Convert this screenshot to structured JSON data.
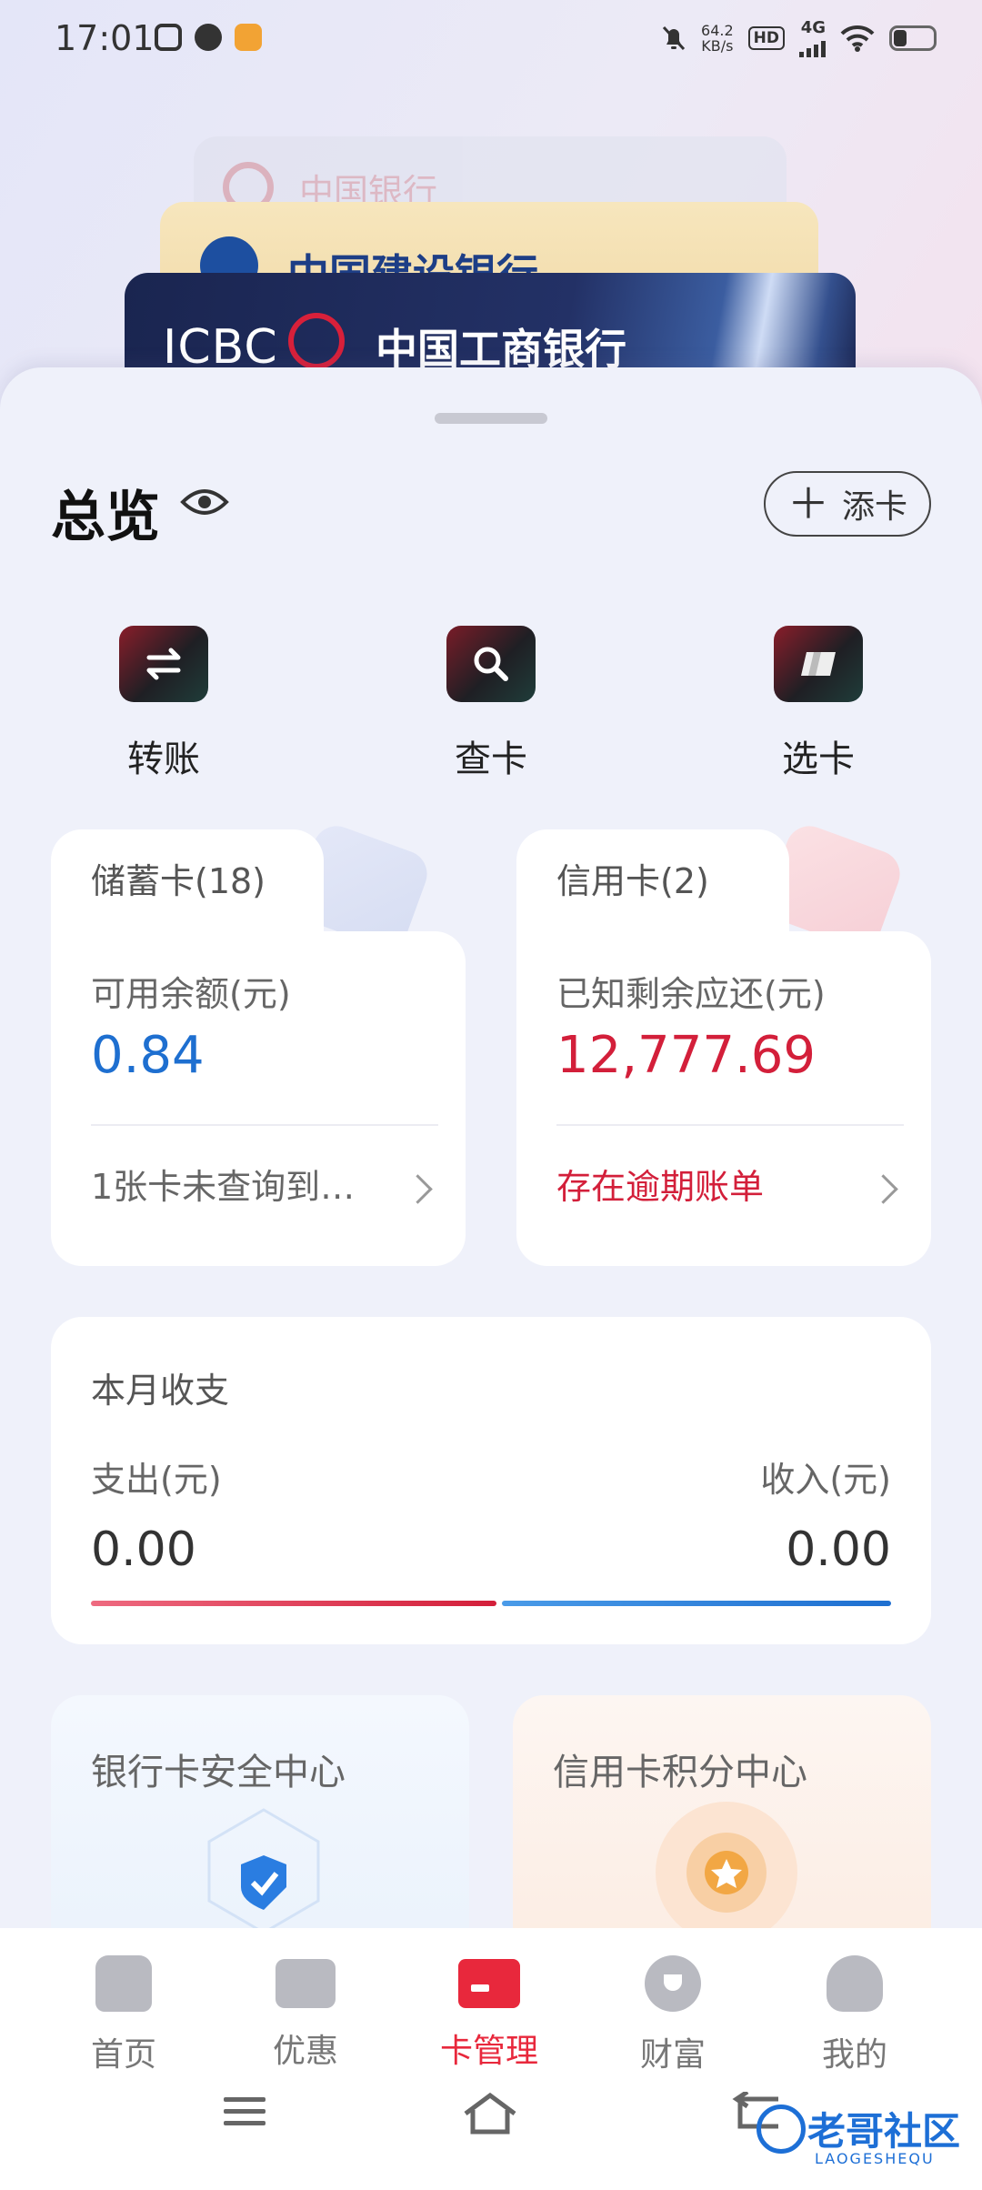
{
  "status_bar": {
    "time": "17:01",
    "net_speed_value": "64.2",
    "net_speed_unit": "KB/s",
    "hd_badge": "HD",
    "signal_label": "4G"
  },
  "cards_stack": [
    {
      "bank": "中国银行"
    },
    {
      "bank": "中国建设银行"
    },
    {
      "brand": "ICBC",
      "bank": "中国工商银行"
    }
  ],
  "overview": {
    "title": "总览",
    "add_card_label": "添卡"
  },
  "quick_actions": [
    {
      "label": "转账",
      "icon": "transfer-icon"
    },
    {
      "label": "查卡",
      "icon": "search-icon"
    },
    {
      "label": "选卡",
      "icon": "card-select-icon"
    }
  ],
  "debit": {
    "tab_label": "储蓄卡(18)",
    "balance_label": "可用余额(元)",
    "balance_value": "0.84",
    "footer_text": "1张卡未查询到…"
  },
  "credit": {
    "tab_label": "信用卡(2)",
    "balance_label": "已知剩余应还(元)",
    "balance_value": "12,777.69",
    "footer_text": "存在逾期账单"
  },
  "monthly": {
    "title": "本月收支",
    "expense_label": "支出(元)",
    "income_label": "收入(元)",
    "expense_value": "0.00",
    "income_value": "0.00"
  },
  "promo": [
    {
      "title": "银行卡安全中心"
    },
    {
      "title": "信用卡积分中心"
    }
  ],
  "bottom_nav": [
    {
      "label": "首页",
      "icon": "home-icon"
    },
    {
      "label": "优惠",
      "icon": "coupon-icon"
    },
    {
      "label": "卡管理",
      "icon": "card-manage-icon",
      "active": true
    },
    {
      "label": "财富",
      "icon": "wealth-icon"
    },
    {
      "label": "我的",
      "icon": "profile-icon"
    }
  ],
  "colors": {
    "accent_red": "#e8283c",
    "debit_blue": "#1e6fd0",
    "credit_red": "#d31f3a"
  },
  "watermark": {
    "text": "老哥社区",
    "sub": "LAOGESHEQU"
  }
}
